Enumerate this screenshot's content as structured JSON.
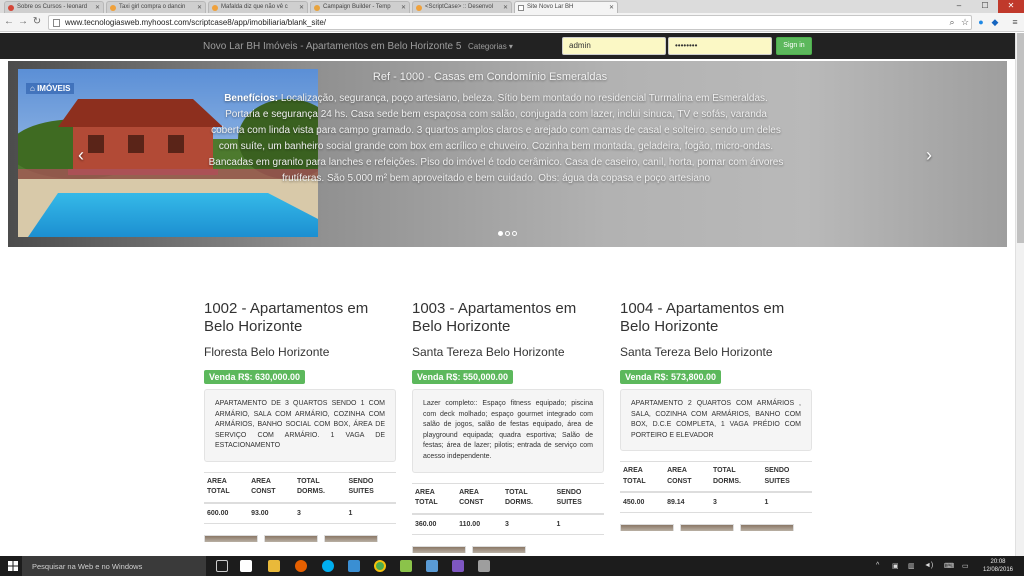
{
  "browser": {
    "tabs": [
      {
        "label": "Sobre os Cursos - leonard",
        "color": "#d44638"
      },
      {
        "label": "Taxi girl compra o dancin",
        "color": "#f0a13b"
      },
      {
        "label": "Mafalda diz que não vê c",
        "color": "#f0a13b"
      },
      {
        "label": "Campaign Builder - Temp",
        "color": "#e8a33d"
      },
      {
        "label": "<ScriptCase> :: Desenvol",
        "color": "#f0a13b"
      },
      {
        "label": "Site Novo Lar BH",
        "color": "#888888"
      }
    ],
    "url": "www.tecnologiasweb.myhoost.com/scriptcase8/app/imobiliaria/blank_site/"
  },
  "sitenav": {
    "brand": "Novo Lar BH Imóveis - Apartamentos em Belo Horizonte 5",
    "categorias": "Categorias",
    "username_value": "admin",
    "password_value": "••••••••",
    "signin_label": "Sign in"
  },
  "carousel": {
    "logo_text": "IMÓVEIS",
    "title": "Ref - 1000 - Casas em Condomínio Esmeraldas",
    "benefits_label": "Benefícios:",
    "benefits_text": "Localização, segurança, poço artesiano, beleza. Sítio bem montado no residencial Turmalina em Esmeraldas. Portaria e segurança 24 hs. Casa sede bem espaçosa com salão, conjugada com lazer, inclui sinuca, TV e sofás, varanda coberta com linda vista para campo gramado. 3 quartos amplos claros e arejado com camas de casal e solteiro. sendo um deles com suíte, um banheiro social grande com box em acrílico e chuveiro. Cozinha bem montada, geladeira, fogão, micro-ondas. Bancadas em granito para lanches e refeições. Piso do imóvel é todo cerâmico. Casa de caseiro, canil, horta, pomar com árvores frutíferas. São 5.000 m² bem aproveitado e bem cuidado. Obs: água da copasa e poço artesiano",
    "prev_icon": "‹",
    "next_icon": "›"
  },
  "spec_headers": {
    "area_total": "AREA TOTAL",
    "area_const": "AREA CONST",
    "total_dorms": "TOTAL DORMS.",
    "sendo_suites": "SENDO SUITES"
  },
  "listings": [
    {
      "title": "1002 - Apartamentos em Belo Horizonte",
      "neighborhood": "Floresta Belo Horizonte",
      "price": "Venda R$: 630,000.00",
      "description": "APARTAMENTO DE 3 QUARTOS SENDO 1 COM ARMÁRIO, SALA COM ARMÁRIO, COZINHA COM ARMÁRIOS, BANHO SOCIAL COM BOX, ÁREA DE SERVIÇO COM ARMÁRIO. 1 VAGA DE ESTACIONAMENTO",
      "area_total": "600.00",
      "area_const": "93.00",
      "dorms": "3",
      "suites": "1"
    },
    {
      "title": "1003 - Apartamentos em Belo Horizonte",
      "neighborhood": "Santa Tereza Belo Horizonte",
      "price": "Venda R$: 550,000.00",
      "description": "Lazer completo:: Espaço fitness equipado; piscina com deck molhado; espaço gourmet integrado com salão de jogos, salão de festas equipado, área de playground equipada; quadra esportiva; Salão de festas; área de lazer; pilotis; entrada de serviço com acesso independente.",
      "area_total": "360.00",
      "area_const": "110.00",
      "dorms": "3",
      "suites": "1"
    },
    {
      "title": "1004 - Apartamentos em Belo Horizonte",
      "neighborhood": "Santa Tereza Belo Horizonte",
      "price": "Venda R$: 573,800.00",
      "description": "APARTAMENTO 2 QUARTOS COM ARMÁRIOS , SALA, COZINHA COM ARMÁRIOS, BANHO COM BOX, D.C.E COMPLETA, 1 VAGA PRÉDIO COM PORTEIRO E ELEVADOR",
      "area_total": "450.00",
      "area_const": "89.14",
      "dorms": "3",
      "suites": "1"
    }
  ],
  "taskbar": {
    "search_placeholder": "Pesquisar na Web e no Windows",
    "time": "20:08",
    "date": "12/08/2016"
  },
  "colors": {
    "navbar": "#222222",
    "success": "#5cb85c"
  }
}
